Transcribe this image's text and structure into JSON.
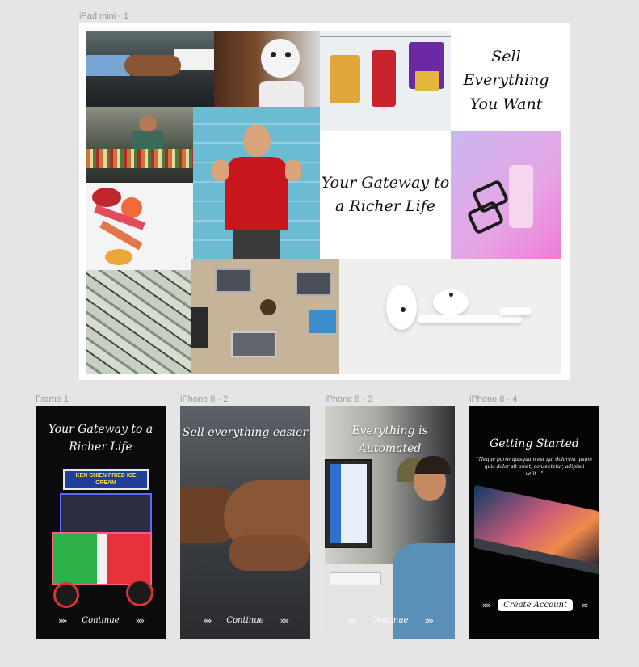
{
  "frames": {
    "ipad": "iPad mini - 1",
    "frame1": "Frame 1",
    "p2": "iPhone 8 - 2",
    "p3": "iPhone 8 - 3",
    "p4": "iPhone 8 - 4"
  },
  "ipad": {
    "caption_sell": "Sell Everything You Want",
    "caption_gateway": "Your Gateway to a Richer Life"
  },
  "phones": {
    "frame1": {
      "title": "Your Gateway to a Richer Life",
      "cart_sign": "KEN CHIEN FRIED ICE CREAM",
      "cta": "Continue"
    },
    "p2": {
      "title": "Sell everything easier",
      "cta": "Continue"
    },
    "p3": {
      "title": "Everything is Automated",
      "cta": "Continue"
    },
    "p4": {
      "title": "Getting Started",
      "body": "\"Neque porro quisquam est qui dolorem ipsum quia dolor sit amet, consectetur, adipisci velit...\"",
      "cta": "Create Account"
    }
  },
  "icons": {
    "chevrons_right": "»»",
    "chevrons_left": "‹‹‹"
  }
}
